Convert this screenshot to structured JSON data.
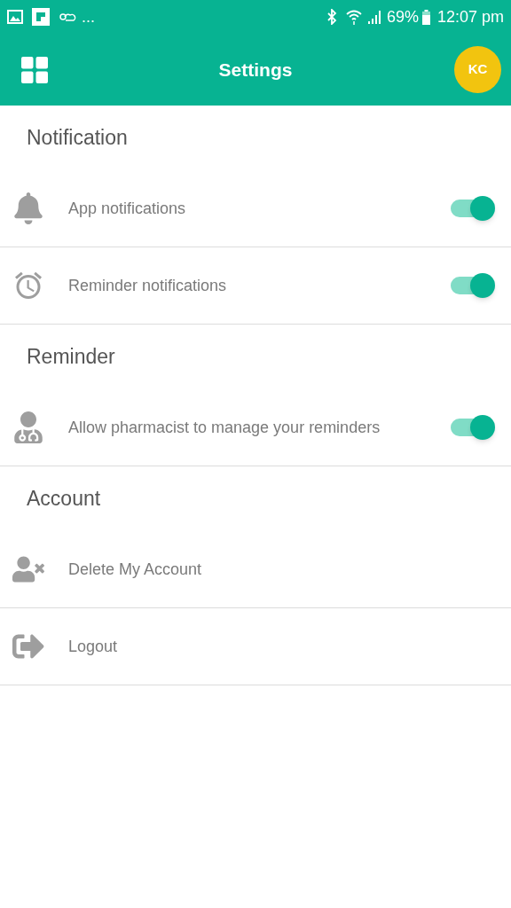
{
  "status_bar": {
    "overflow": "...",
    "battery": "69%",
    "time": "12:07 pm"
  },
  "header": {
    "title": "Settings",
    "avatar": "KC"
  },
  "sections": [
    {
      "title": "Notification",
      "items": [
        {
          "kind": "toggle",
          "label": "App notifications",
          "on": true
        },
        {
          "kind": "toggle",
          "label": "Reminder notifications",
          "on": true
        }
      ]
    },
    {
      "title": "Reminder",
      "items": [
        {
          "kind": "toggle",
          "label": "Allow pharmacist to manage your reminders",
          "on": true
        }
      ]
    },
    {
      "title": "Account",
      "items": [
        {
          "kind": "link",
          "label": "Delete My Account"
        },
        {
          "kind": "link",
          "label": "Logout"
        }
      ]
    }
  ]
}
